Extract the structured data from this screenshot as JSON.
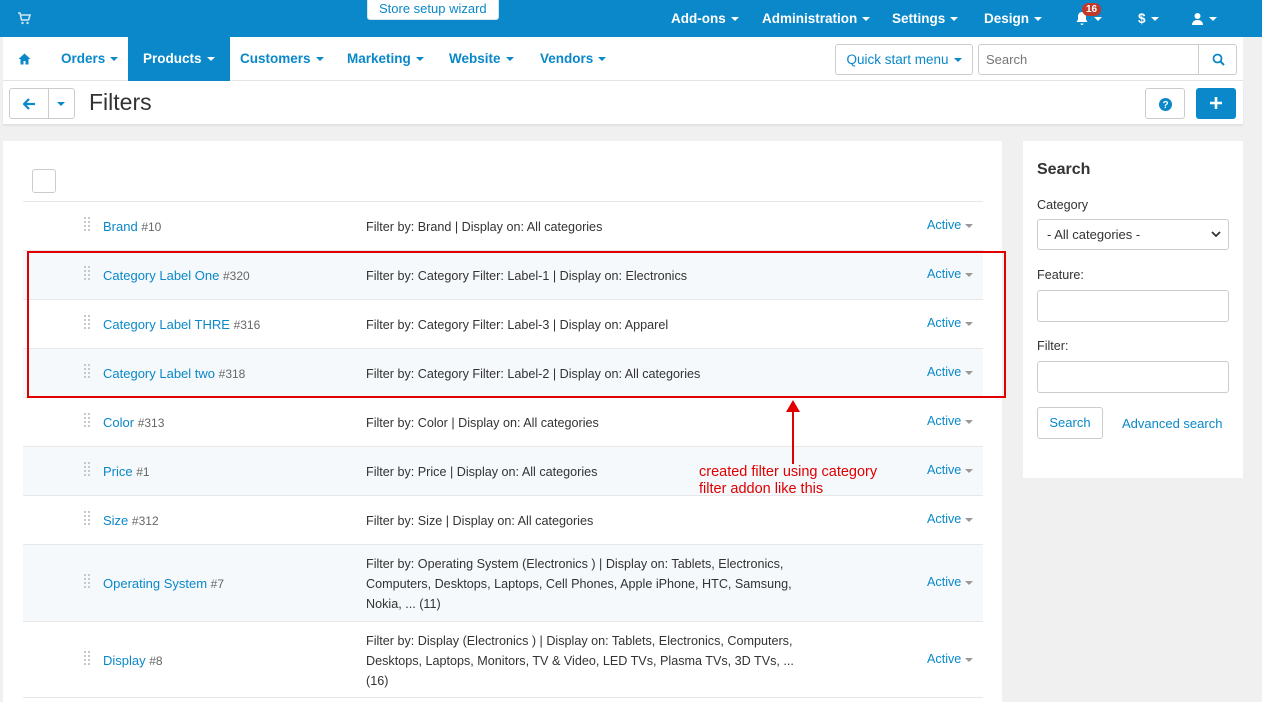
{
  "topbar": {
    "wizard_label": "Store setup wizard",
    "menus": [
      "Add-ons",
      "Administration",
      "Settings",
      "Design"
    ],
    "notification_count": "16",
    "currency": "$"
  },
  "mainnav": {
    "items": [
      "Orders",
      "Products",
      "Customers",
      "Marketing",
      "Website",
      "Vendors"
    ],
    "active": "Products",
    "quickstart_label": "Quick start menu",
    "search_placeholder": "Search"
  },
  "page": {
    "title": "Filters"
  },
  "filters": [
    {
      "name": "Brand",
      "id": "#10",
      "desc": [
        "Filter by: Brand | Display on: All categories"
      ],
      "status": "Active"
    },
    {
      "name": "Category Label One",
      "id": "#320",
      "desc": [
        "Filter by: Category Filter: Label-1 | Display on: Electronics"
      ],
      "status": "Active"
    },
    {
      "name": "Category Label THRE",
      "id": "#316",
      "desc": [
        "Filter by: Category Filter: Label-3 | Display on: Apparel"
      ],
      "status": "Active"
    },
    {
      "name": "Category Label two",
      "id": "#318",
      "desc": [
        "Filter by: Category Filter: Label-2 | Display on: All categories"
      ],
      "status": "Active"
    },
    {
      "name": "Color",
      "id": "#313",
      "desc": [
        "Filter by: Color | Display on: All categories"
      ],
      "status": "Active"
    },
    {
      "name": "Price",
      "id": "#1",
      "desc": [
        "Filter by: Price | Display on: All categories"
      ],
      "status": "Active"
    },
    {
      "name": "Size",
      "id": "#312",
      "desc": [
        "Filter by: Size | Display on: All categories"
      ],
      "status": "Active"
    },
    {
      "name": "Operating System",
      "id": "#7",
      "desc": [
        "Filter by: Operating System (Electronics ) | Display on: Tablets, Electronics,",
        "Computers, Desktops, Laptops, Cell Phones, Apple iPhone, HTC, Samsung,",
        "Nokia, ... (11)"
      ],
      "status": "Active"
    },
    {
      "name": "Display",
      "id": "#8",
      "desc": [
        "Filter by: Display (Electronics ) | Display on: Tablets, Electronics, Computers,",
        "Desktops, Laptops, Monitors, TV & Video, LED TVs, Plasma TVs, 3D TVs, ...",
        "(16)"
      ],
      "status": "Active"
    }
  ],
  "annotation": {
    "lines": [
      "created filter using category",
      "filter addon like this"
    ],
    "color": "#e00000"
  },
  "sidebar": {
    "title": "Search",
    "category_label": "Category",
    "category_value": "- All categories -",
    "feature_label": "Feature:",
    "filter_label": "Filter:",
    "search_button": "Search",
    "advanced_link": "Advanced search"
  },
  "colors": {
    "brand": "#0a88c9",
    "background": "#f0f0f0"
  }
}
